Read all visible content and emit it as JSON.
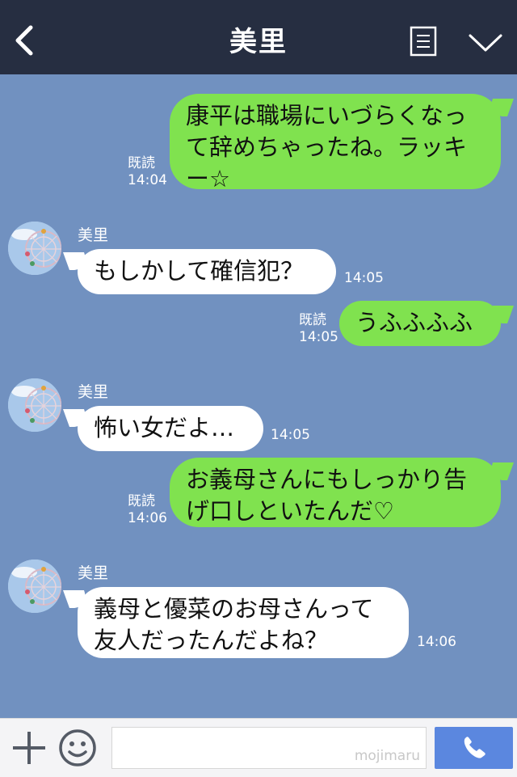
{
  "header": {
    "title": "美里",
    "back_icon": "chevron-left-icon",
    "menu_icon": "menu-list-icon",
    "collapse_icon": "chevron-down-icon"
  },
  "messages": [
    {
      "direction": "outgoing",
      "text": "康平は職場にいづらくなって辞めちゃったね。ラッキー☆",
      "read": "既読",
      "time": "14:04"
    },
    {
      "direction": "incoming",
      "sender": "美里",
      "text": "もしかして確信犯？",
      "time": "14:05"
    },
    {
      "direction": "outgoing",
      "text": "うふふふふ",
      "read": "既読",
      "time": "14:05"
    },
    {
      "direction": "incoming",
      "sender": "美里",
      "text": "怖い女だよ…",
      "time": "14:05"
    },
    {
      "direction": "outgoing",
      "text": "お義母さんにもしっかり告げ口しといたんだ♡",
      "read": "既読",
      "time": "14:06"
    },
    {
      "direction": "incoming",
      "sender": "美里",
      "text": "義母と優菜のお母さんって友人だったんだよね？",
      "time": "14:06"
    }
  ],
  "footer": {
    "input_placeholder": "",
    "watermark": "mojimaru",
    "plus_icon": "plus-icon",
    "emoji_icon": "smiley-icon",
    "call_icon": "phone-icon"
  },
  "colors": {
    "header_bg": "#262e41",
    "chat_bg": "#7191c0",
    "outgoing_bubble": "#80e24f",
    "incoming_bubble": "#ffffff",
    "call_button": "#5b87df"
  }
}
